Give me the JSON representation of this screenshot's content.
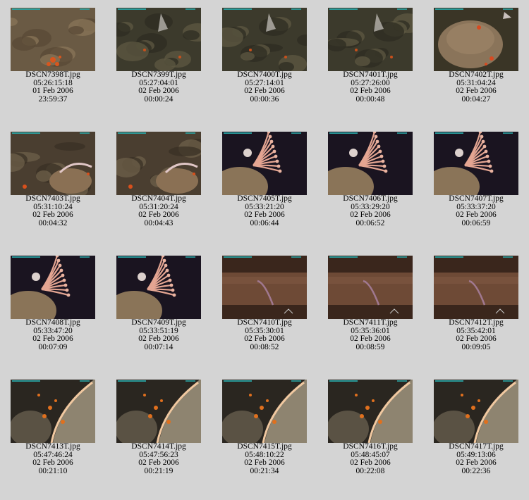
{
  "thumbnails": [
    {
      "filename": "DSCN7398T.jpg",
      "timecode": "05:26:15:18",
      "date": "01 Feb 2006",
      "elapsed": "23:59:37",
      "scene": "rock-pale"
    },
    {
      "filename": "DSCN7399T.jpg",
      "timecode": "05:27:04:01",
      "date": "02 Feb 2006",
      "elapsed": "00:00:24",
      "scene": "rock-dark"
    },
    {
      "filename": "DSCN7400T.jpg",
      "timecode": "05:27:14:01",
      "date": "02 Feb 2006",
      "elapsed": "00:00:36",
      "scene": "rock-dark"
    },
    {
      "filename": "DSCN7401T.jpg",
      "timecode": "05:27:26:00",
      "date": "02 Feb 2006",
      "elapsed": "00:00:48",
      "scene": "rock-dark"
    },
    {
      "filename": "DSCN7402T.jpg",
      "timecode": "05:31:04:24",
      "date": "02 Feb 2006",
      "elapsed": "00:04:27",
      "scene": "boulder"
    },
    {
      "filename": "DSCN7403T.jpg",
      "timecode": "05:31:10:24",
      "date": "02 Feb 2006",
      "elapsed": "00:04:32",
      "scene": "rock-coral"
    },
    {
      "filename": "DSCN7404T.jpg",
      "timecode": "05:31:20:24",
      "date": "02 Feb 2006",
      "elapsed": "00:04:43",
      "scene": "rock-coral"
    },
    {
      "filename": "DSCN7405T.jpg",
      "timecode": "05:33:21:20",
      "date": "02 Feb 2006",
      "elapsed": "00:06:44",
      "scene": "fan"
    },
    {
      "filename": "DSCN7406T.jpg",
      "timecode": "05:33:29:20",
      "date": "02 Feb 2006",
      "elapsed": "00:06:52",
      "scene": "fan"
    },
    {
      "filename": "DSCN7407T.jpg",
      "timecode": "05:33:37:20",
      "date": "02 Feb 2006",
      "elapsed": "00:06:59",
      "scene": "fan"
    },
    {
      "filename": "DSCN7408T.jpg",
      "timecode": "05:33:47:20",
      "date": "02 Feb 2006",
      "elapsed": "00:07:09",
      "scene": "fan"
    },
    {
      "filename": "DSCN7409T.jpg",
      "timecode": "05:33:51:19",
      "date": "02 Feb 2006",
      "elapsed": "00:07:14",
      "scene": "fan"
    },
    {
      "filename": "DSCN7410T.jpg",
      "timecode": "05:35:30:01",
      "date": "02 Feb 2006",
      "elapsed": "00:08:52",
      "scene": "ledge"
    },
    {
      "filename": "DSCN7411T.jpg",
      "timecode": "05:35:36:01",
      "date": "02 Feb 2006",
      "elapsed": "00:08:59",
      "scene": "ledge"
    },
    {
      "filename": "DSCN7412T.jpg",
      "timecode": "05:35:42:01",
      "date": "02 Feb 2006",
      "elapsed": "00:09:05",
      "scene": "ledge"
    },
    {
      "filename": "DSCN7413T.jpg",
      "timecode": "05:47:46:24",
      "date": "02 Feb 2006",
      "elapsed": "00:21:10",
      "scene": "ridge"
    },
    {
      "filename": "DSCN7414T.jpg",
      "timecode": "05:47:56:23",
      "date": "02 Feb 2006",
      "elapsed": "00:21:19",
      "scene": "ridge"
    },
    {
      "filename": "DSCN7415T.jpg",
      "timecode": "05:48:10:22",
      "date": "02 Feb 2006",
      "elapsed": "00:21:34",
      "scene": "ridge"
    },
    {
      "filename": "DSCN7416T.jpg",
      "timecode": "05:48:45:07",
      "date": "02 Feb 2006",
      "elapsed": "00:22:08",
      "scene": "ridge"
    },
    {
      "filename": "DSCN7417T.jpg",
      "timecode": "05:49:13:06",
      "date": "02 Feb 2006",
      "elapsed": "00:22:36",
      "scene": "ridge"
    }
  ],
  "colors": {
    "background": "#d4d4d4",
    "text": "#000000",
    "overlay_text": "#2aa6a6"
  }
}
